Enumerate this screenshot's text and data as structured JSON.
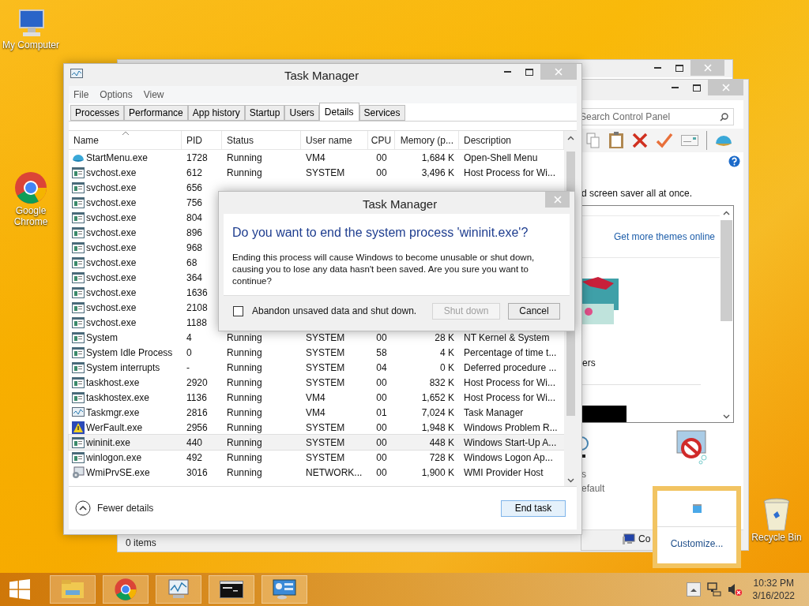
{
  "desktop_icons": [
    {
      "label": "My Computer",
      "kind": "computer"
    },
    {
      "label": "Google Chrome",
      "kind": "chrome"
    },
    {
      "label": "Recycle Bin",
      "kind": "recycle"
    }
  ],
  "back_window": {
    "status": "0 items"
  },
  "control_panel": {
    "search": {
      "placeholder": "Search Control Panel"
    },
    "intro": "d screen saver all at once.",
    "link": "Get more themes online",
    "theme_label": "ers",
    "label_a": "s",
    "label_b": "efault",
    "status": "Co"
  },
  "task_manager": {
    "title": "Task Manager",
    "menu": [
      "File",
      "Options",
      "View"
    ],
    "tabs": [
      {
        "label": "Processes",
        "selected": false
      },
      {
        "label": "Performance",
        "selected": false
      },
      {
        "label": "App history",
        "selected": false
      },
      {
        "label": "Startup",
        "selected": false
      },
      {
        "label": "Users",
        "selected": false
      },
      {
        "label": "Details",
        "selected": true
      },
      {
        "label": "Services",
        "selected": false
      }
    ],
    "columns": [
      {
        "label": "Name",
        "sorted": true
      },
      {
        "label": "PID",
        "sorted": false
      },
      {
        "label": "Status",
        "sorted": false
      },
      {
        "label": "User name",
        "sorted": false
      },
      {
        "label": "CPU",
        "sorted": false
      },
      {
        "label": "Memory (p...",
        "sorted": false
      },
      {
        "label": "Description",
        "sorted": false
      }
    ],
    "rows": [
      {
        "kind": "shell",
        "name": "StartMenu.exe",
        "pid": "1728",
        "status": "Running",
        "user": "VM4",
        "cpu": "00",
        "memory": "1,684 K",
        "description": "Open-Shell Menu",
        "selected": false
      },
      {
        "kind": "window",
        "name": "svchost.exe",
        "pid": "612",
        "status": "Running",
        "user": "SYSTEM",
        "cpu": "00",
        "memory": "3,496 K",
        "description": "Host Process for Wi...",
        "selected": false
      },
      {
        "kind": "window",
        "name": "svchost.exe",
        "pid": "656",
        "selected": false
      },
      {
        "kind": "window",
        "name": "svchost.exe",
        "pid": "756",
        "selected": false
      },
      {
        "kind": "window",
        "name": "svchost.exe",
        "pid": "804",
        "selected": false
      },
      {
        "kind": "window",
        "name": "svchost.exe",
        "pid": "896",
        "selected": false
      },
      {
        "kind": "window",
        "name": "svchost.exe",
        "pid": "968",
        "selected": false
      },
      {
        "kind": "window",
        "name": "svchost.exe",
        "pid": "68",
        "selected": false
      },
      {
        "kind": "window",
        "name": "svchost.exe",
        "pid": "364",
        "selected": false
      },
      {
        "kind": "window",
        "name": "svchost.exe",
        "pid": "1636",
        "selected": false
      },
      {
        "kind": "window",
        "name": "svchost.exe",
        "pid": "2108",
        "selected": false
      },
      {
        "kind": "window",
        "name": "svchost.exe",
        "pid": "1188",
        "selected": false
      },
      {
        "kind": "window",
        "name": "System",
        "pid": "4",
        "status": "Running",
        "user": "SYSTEM",
        "cpu": "00",
        "memory": "28 K",
        "description": "NT Kernel & System",
        "selected": false
      },
      {
        "kind": "window",
        "name": "System Idle Process",
        "pid": "0",
        "status": "Running",
        "user": "SYSTEM",
        "cpu": "58",
        "memory": "4 K",
        "description": "Percentage of time t...",
        "selected": false
      },
      {
        "kind": "window",
        "name": "System interrupts",
        "pid": "-",
        "status": "Running",
        "user": "SYSTEM",
        "cpu": "04",
        "memory": "0 K",
        "description": "Deferred procedure ...",
        "selected": false
      },
      {
        "kind": "window",
        "name": "taskhost.exe",
        "pid": "2920",
        "status": "Running",
        "user": "SYSTEM",
        "cpu": "00",
        "memory": "832 K",
        "description": "Host Process for Wi...",
        "selected": false
      },
      {
        "kind": "window",
        "name": "taskhostex.exe",
        "pid": "1136",
        "status": "Running",
        "user": "VM4",
        "cpu": "00",
        "memory": "1,652 K",
        "description": "Host Process for Wi...",
        "selected": false
      },
      {
        "kind": "taskmgr",
        "name": "Taskmgr.exe",
        "pid": "2816",
        "status": "Running",
        "user": "VM4",
        "cpu": "01",
        "memory": "7,024 K",
        "description": "Task Manager",
        "selected": false
      },
      {
        "kind": "werfault",
        "name": "WerFault.exe",
        "pid": "2956",
        "status": "Running",
        "user": "SYSTEM",
        "cpu": "00",
        "memory": "1,948 K",
        "description": "Windows Problem R...",
        "selected": false
      },
      {
        "kind": "window",
        "name": "wininit.exe",
        "pid": "440",
        "status": "Running",
        "user": "SYSTEM",
        "cpu": "00",
        "memory": "448 K",
        "description": "Windows Start-Up A...",
        "selected": true
      },
      {
        "kind": "window",
        "name": "winlogon.exe",
        "pid": "492",
        "status": "Running",
        "user": "SYSTEM",
        "cpu": "00",
        "memory": "728 K",
        "description": "Windows Logon Ap...",
        "selected": false
      },
      {
        "kind": "wmi",
        "name": "WmiPrvSE.exe",
        "pid": "3016",
        "status": "Running",
        "user": "NETWORK...",
        "cpu": "00",
        "memory": "1,900 K",
        "description": "WMI Provider Host",
        "selected": false
      }
    ],
    "fewer_details": "Fewer details",
    "end_task": "End task"
  },
  "dialog": {
    "title": "Task Manager",
    "heading": "Do you want to end the system process 'wininit.exe'?",
    "body": "Ending this process will cause Windows to become unusable or shut down, causing you to lose any data hasn't been saved. Are you sure you want to continue?",
    "checkbox": {
      "label": "Abandon unsaved data and shut down.",
      "checked": false
    },
    "buttons": [
      {
        "label": "Shut down",
        "disabled": true
      },
      {
        "label": "Cancel",
        "disabled": false
      }
    ]
  },
  "tray_popup": {
    "link": "Customize..."
  },
  "taskbar": {
    "apps": [
      {
        "kind": "explorer"
      },
      {
        "kind": "chrome"
      },
      {
        "kind": "taskmgr"
      },
      {
        "kind": "cmd"
      },
      {
        "kind": "controlpanel"
      }
    ],
    "time": "10:32 PM",
    "date": "3/16/2022"
  }
}
